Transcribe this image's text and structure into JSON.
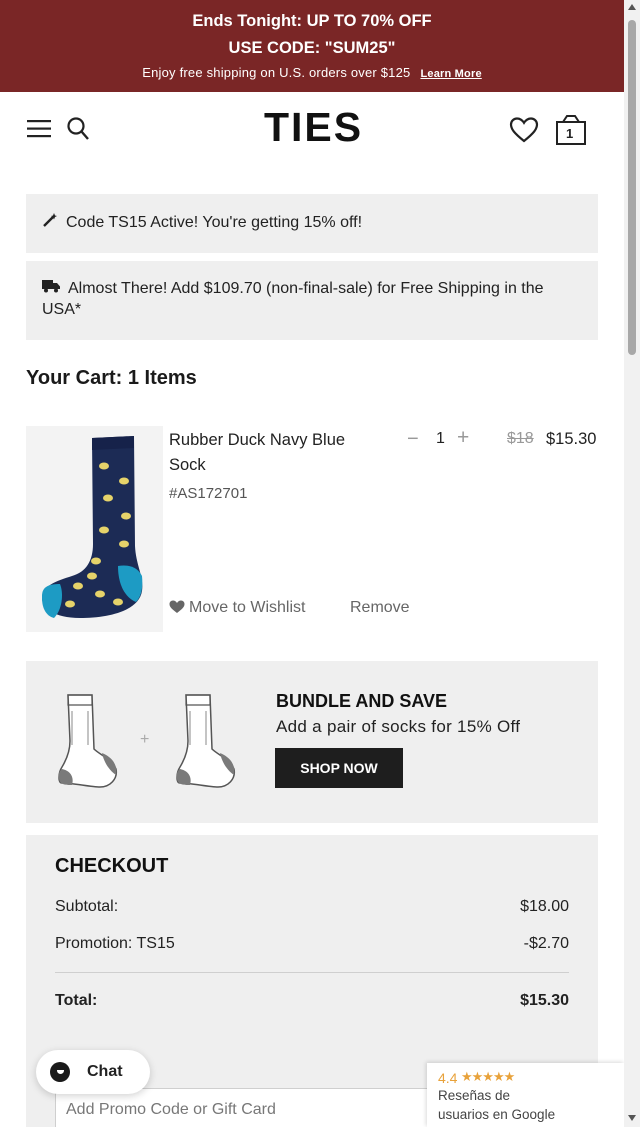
{
  "promo_banner": {
    "line1": "Ends Tonight: UP TO 70% OFF",
    "line2": "USE CODE: \"SUM25\"",
    "line3": "Enjoy free shipping on U.S. orders over $125",
    "learn_more": "Learn More",
    "background_color": "#7a2626"
  },
  "header": {
    "logo": "TIES",
    "menu_icon": "hamburger-menu-icon",
    "search_icon": "search-icon",
    "wishlist_icon": "heart-icon",
    "cart_icon": "cart-bag-icon",
    "cart_count": "1"
  },
  "notices": {
    "promo_code": "Code TS15 Active! You're getting 15% off!",
    "shipping": "Almost There! Add $109.70 (non-final-sale) for Free Shipping in the USA*"
  },
  "cart": {
    "title": "Your Cart: 1 Items",
    "items": [
      {
        "name": "Rubber Duck Navy Blue Sock",
        "sku": "#AS172701",
        "quantity": "1",
        "minus": "−",
        "plus": "+",
        "price_original": "$18",
        "price_sale": "$15.30",
        "move_to_wishlist": "Move to Wishlist",
        "remove": "Remove"
      }
    ]
  },
  "bundle": {
    "title": "BUNDLE AND SAVE",
    "subtitle": "Add a pair of socks for 15% Off",
    "plus": "+",
    "button": "SHOP NOW"
  },
  "checkout": {
    "title": "CHECKOUT",
    "subtotal_label": "Subtotal:",
    "subtotal_value": "$18.00",
    "promotion_label": "Promotion: TS15",
    "promotion_value": "-$2.70",
    "total_label": "Total:",
    "total_value": "$15.30",
    "promo_placeholder": "Add Promo Code or Gift Card"
  },
  "chat": {
    "label": "Chat"
  },
  "google_reviews": {
    "score": "4.4",
    "stars": "★★★★★",
    "line1": "Reseñas de",
    "line2": "usuarios en Google"
  }
}
